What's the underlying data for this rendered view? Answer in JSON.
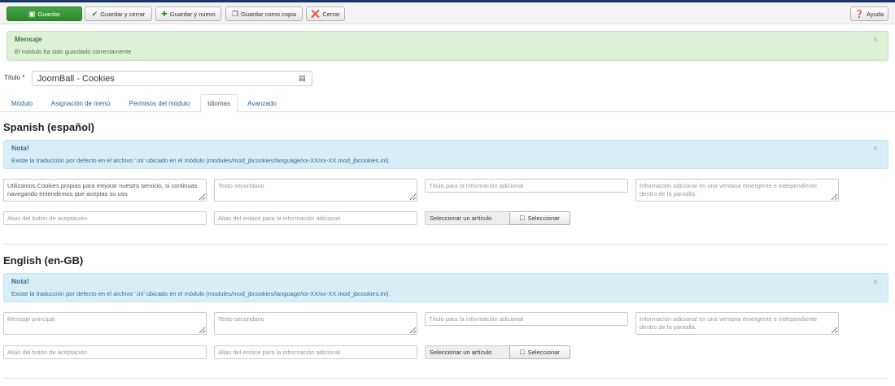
{
  "toolbar": {
    "save": "Guardar",
    "save_close": "Guardar y cerrar",
    "save_new": "Guardar y nuevo",
    "save_copy": "Guardar como copia",
    "close": "Cerrar",
    "help": "Ayuda"
  },
  "message": {
    "title": "Mensaje",
    "text": "El módulo ha sido guardado correctamente",
    "close": "×"
  },
  "title_field": {
    "label": "Título *",
    "value": "JoomBall - Cookies"
  },
  "tabs": [
    "Módulo",
    "Asignación de menú",
    "Permisos del módulo",
    "Idiomas",
    "Avanzado"
  ],
  "active_tab": "Idiomas",
  "languages": [
    {
      "heading": "Spanish (español)",
      "note_title": "Nota!",
      "note_text": "Existe la traducción por defecto en el archivo '.ini' ubicado en el módulo (modules/mod_jbcookies/language/xx-XX/xx-XX.mod_jbcookies.ini).",
      "close": "×",
      "main_message_value": "Utilizamos Cookies propias para mejorar nuestro servicio, si continuas navegando entendemos que aceptas su uso",
      "main_message_placeholder": "Mensaje principal",
      "secondary_placeholder": "Texto secundario",
      "info_title_placeholder": "Título para la información adicional",
      "info_popup_placeholder": "Información adicional en una ventana emergente e independiente dentro de la pantalla.",
      "accept_alias_placeholder": "Alias del botón de aceptación",
      "link_alias_placeholder": "Alias del enlace para la información adicional",
      "select_article": "Seleccionar un artículo",
      "select_button": "Seleccionar"
    },
    {
      "heading": "English (en-GB)",
      "note_title": "Nota!",
      "note_text": "Existe la traducción por defecto en el archivo '.ini' ubicado en el módulo (modules/mod_jbcookies/language/xx-XX/xx-XX.mod_jbcookies.ini).",
      "close": "×",
      "main_message_value": "",
      "main_message_placeholder": "Mensaje principal",
      "secondary_placeholder": "Texto secundario",
      "info_title_placeholder": "Título para la información adicional",
      "info_popup_placeholder": "Información adicional en una ventana emergente e independiente dentro de la pantalla.",
      "accept_alias_placeholder": "Alias del botón de aceptación",
      "link_alias_placeholder": "Alias del enlace para la información adicional",
      "select_article": "Seleccionar un artículo",
      "select_button": "Seleccionar"
    }
  ],
  "colors": {
    "success": "#2f8a2f",
    "danger": "#bd362f",
    "link": "#2a6496",
    "topbar": "#1a3867"
  }
}
